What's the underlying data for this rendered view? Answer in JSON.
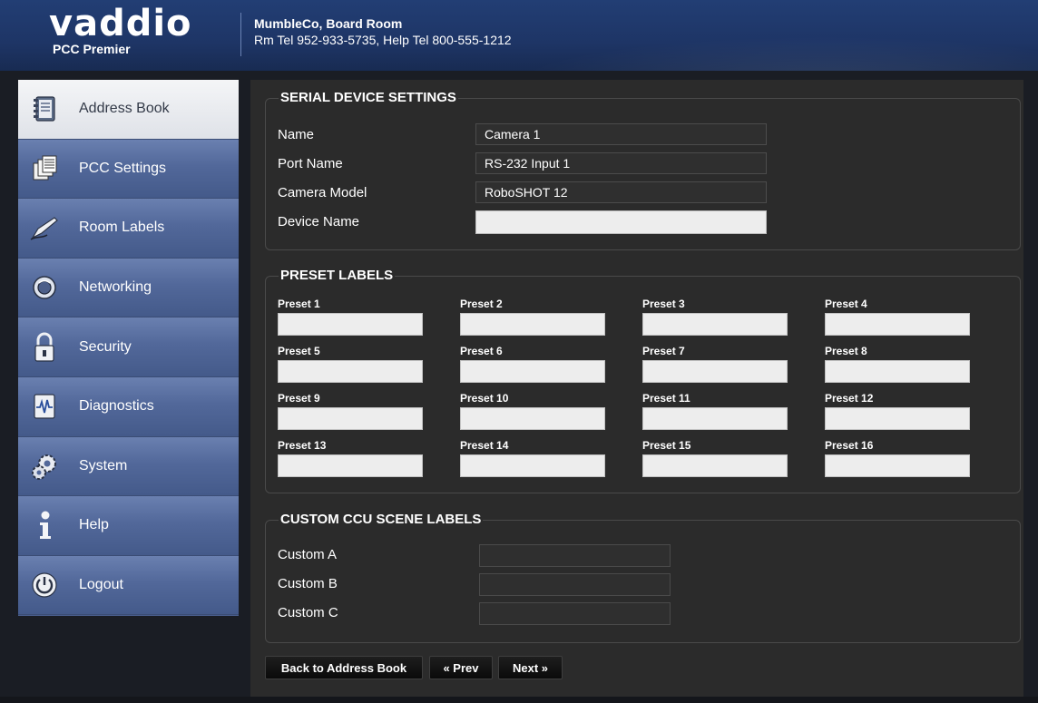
{
  "header": {
    "logo": "vaddio",
    "product": "PCC Premier",
    "room_name": "MumbleCo, Board Room",
    "room_tel": "Rm Tel 952-933-5735, Help Tel 800-555-1212"
  },
  "sidebar": {
    "items": [
      {
        "label": "Address Book",
        "icon": "address-book-icon",
        "active": true
      },
      {
        "label": "PCC Settings",
        "icon": "settings-icon"
      },
      {
        "label": "Room Labels",
        "icon": "pen-icon"
      },
      {
        "label": "Networking",
        "icon": "network-icon"
      },
      {
        "label": "Security",
        "icon": "lock-icon"
      },
      {
        "label": "Diagnostics",
        "icon": "diagnostics-icon"
      },
      {
        "label": "System",
        "icon": "gears-icon"
      },
      {
        "label": "Help",
        "icon": "info-icon"
      },
      {
        "label": "Logout",
        "icon": "power-icon"
      }
    ]
  },
  "serial": {
    "title": "SERIAL DEVICE SETTINGS",
    "name_label": "Name",
    "name_value": "Camera 1",
    "port_label": "Port Name",
    "port_value": "RS-232 Input 1",
    "model_label": "Camera Model",
    "model_value": "RoboSHOT 12",
    "device_label": "Device Name",
    "device_value": ""
  },
  "presets": {
    "title": "PRESET LABELS",
    "items": [
      "Preset 1",
      "Preset 2",
      "Preset 3",
      "Preset 4",
      "Preset 5",
      "Preset 6",
      "Preset 7",
      "Preset 8",
      "Preset 9",
      "Preset 10",
      "Preset 11",
      "Preset 12",
      "Preset 13",
      "Preset 14",
      "Preset 15",
      "Preset 16"
    ]
  },
  "ccu": {
    "title": "CUSTOM CCU SCENE LABELS",
    "items": [
      "Custom A",
      "Custom B",
      "Custom C"
    ]
  },
  "buttons": {
    "back": "Back to Address Book",
    "prev": "« Prev",
    "next": "Next »"
  },
  "colors": {
    "header": "#1e3566",
    "nav": "#52689a",
    "panel_bg": "#2b2b2b"
  }
}
